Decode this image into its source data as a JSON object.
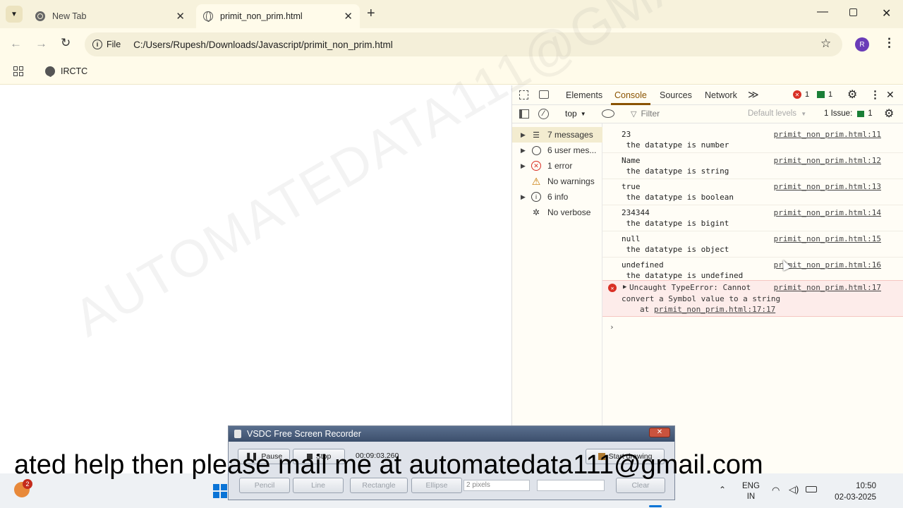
{
  "tabs": [
    {
      "title": "New Tab"
    },
    {
      "title": "primit_non_prim.html"
    }
  ],
  "address": {
    "scheme": "File",
    "url": "C:/Users/Rupesh/Downloads/Javascript/primit_non_prim.html"
  },
  "profile_initial": "R",
  "bookmarks": [
    {
      "label": "IRCTC"
    }
  ],
  "devtools": {
    "tabs": [
      "Elements",
      "Console",
      "Sources",
      "Network"
    ],
    "more": "≫",
    "error_count": "1",
    "msg_count": "1",
    "context": "top",
    "filter_placeholder": "Filter",
    "levels": "Default levels",
    "issues": "1 Issue:",
    "issues_count": "1",
    "sidebar": [
      {
        "label": "7 messages"
      },
      {
        "label": "6 user mes..."
      },
      {
        "label": "1 error"
      },
      {
        "label": "No warnings"
      },
      {
        "label": "6 info"
      },
      {
        "label": "No verbose"
      }
    ],
    "messages": [
      {
        "value": "23",
        "text": " the datatype is number",
        "src": "primit_non_prim.html:11"
      },
      {
        "value": "Name",
        "text": " the datatype is string",
        "src": "primit_non_prim.html:12"
      },
      {
        "value": "true",
        "text": " the datatype is boolean",
        "src": "primit_non_prim.html:13"
      },
      {
        "value": "234344",
        "text": " the datatype is bigint",
        "src": "primit_non_prim.html:14"
      },
      {
        "value": "null",
        "text": " the datatype is object",
        "src": "primit_non_prim.html:15"
      },
      {
        "value": "undefined",
        "text": " the datatype is undefined",
        "src": "primit_non_prim.html:16"
      }
    ],
    "error": {
      "line1": "Uncaught TypeError: Cannot",
      "line2": "convert a Symbol value to a string",
      "at": "at",
      "at_src": "primit_non_prim.html:17:17",
      "src": "primit_non_prim.html:17"
    }
  },
  "watermark": "AUTOMATEDATA111@GMAIL.COM",
  "vsdc": {
    "title": "VSDC Free Screen Recorder",
    "pause": "Pause",
    "stop": "Stop",
    "timer": "00:09:03.260",
    "start_drawing": "Start drawing",
    "pencil": "Pencil",
    "line": "Line",
    "rectangle": "Rectangle",
    "ellipse": "Ellipse",
    "pixels": "2 pixels",
    "clear": "Clear"
  },
  "caption": "ated help then please mail  me  at automatedata111@gmail.com",
  "taskbar": {
    "badge": "2",
    "lang1": "ENG",
    "lang2": "IN",
    "time": "10:50",
    "date": "02-03-2025"
  },
  "colors": {
    "accent": "#d93025",
    "chrome_bg": "#f7f2dc",
    "toolbar_bg": "#fffbea"
  }
}
